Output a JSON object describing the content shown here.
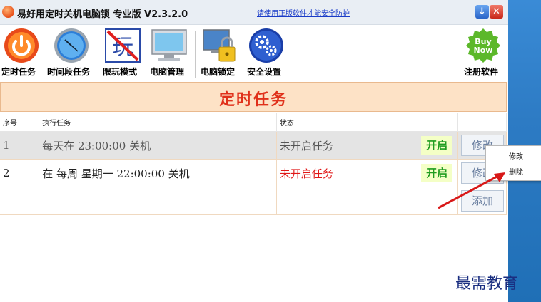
{
  "titlebar": {
    "title": "易好用定时关机电脑锁 专业版 V2.3.2.0",
    "link": "请使用正版软件才能安全防护",
    "minimize_glyph": "↓",
    "close_glyph": "✕"
  },
  "toolbar": {
    "items": [
      {
        "label": "定时任务",
        "icon": "power-icon"
      },
      {
        "label": "时间段任务",
        "icon": "clock-icon"
      },
      {
        "label": "限玩模式",
        "icon": "no-play-icon"
      },
      {
        "label": "电脑管理",
        "icon": "monitor-icon"
      },
      {
        "label": "电脑锁定",
        "icon": "lock-computer-icon"
      },
      {
        "label": "安全设置",
        "icon": "gear-icon"
      }
    ],
    "buy_label": "注册软件",
    "buy_badge": "Buy Now"
  },
  "banner": "定时任务",
  "table": {
    "headers": [
      "序号",
      "执行任务",
      "状态",
      "",
      ""
    ],
    "rows": [
      {
        "no": "1",
        "task": "每天在 23:00:00 关机",
        "status": "未开启任务",
        "on": "开启",
        "edit": "修改"
      },
      {
        "no": "2",
        "task": "在 每周 星期一 22:00:00 关机",
        "status": "未开启任务",
        "on": "开启",
        "edit": "修改"
      }
    ],
    "add_label": "添加"
  },
  "context_menu": {
    "items": [
      "修改",
      "删除"
    ]
  },
  "watermark": "最需教育",
  "colors": {
    "accent_red": "#e0301a",
    "on_green": "#1f9c1f",
    "banner_bg": "#fde2c6"
  }
}
